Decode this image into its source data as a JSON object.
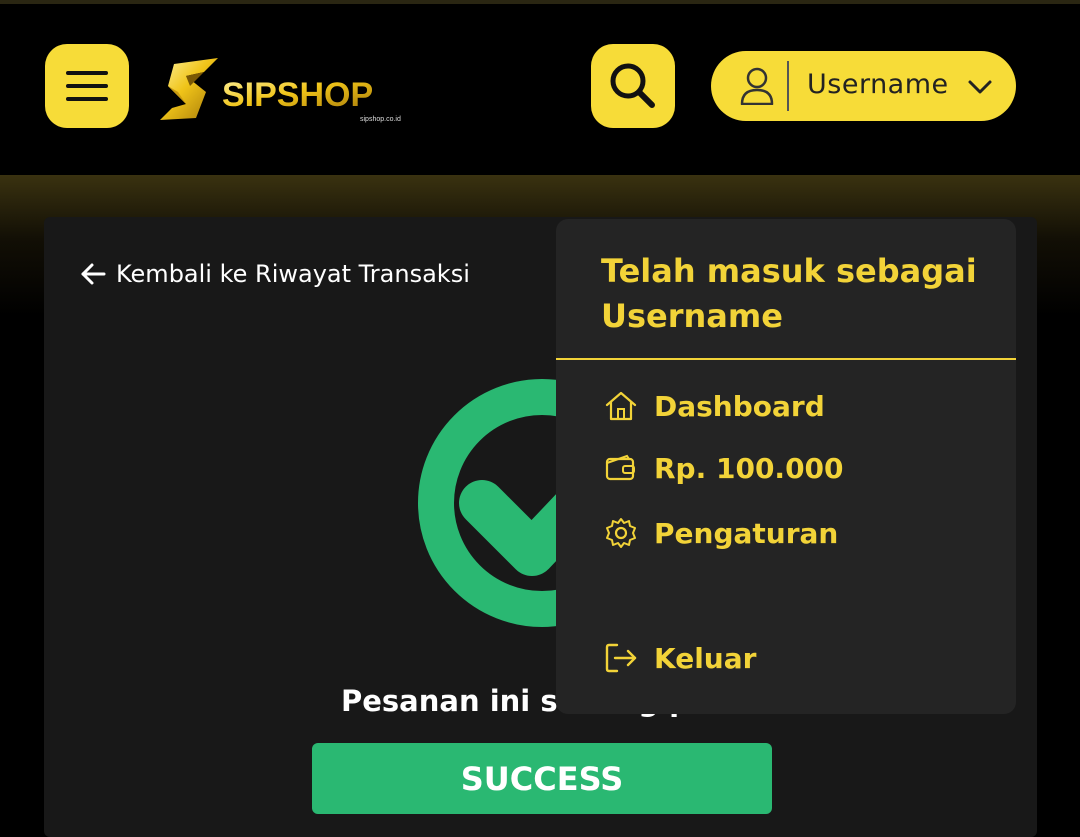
{
  "header": {
    "logo_text": "SIPSHOP",
    "logo_subtext": "sipshop.co.id",
    "username": "Username",
    "icons": {
      "menu": "hamburger-menu-icon",
      "search": "search-icon",
      "user": "user-icon",
      "chevron": "chevron-down-icon"
    }
  },
  "colors": {
    "accent": "#f7dc38",
    "success": "#2ab872",
    "background": "#000000",
    "card": "#181818",
    "dropdown": "#242424"
  },
  "page": {
    "back_link": "Kembali ke Riwayat Transaksi",
    "status_text": "Pesanan ini sedang p",
    "success_label": "SUCCESS"
  },
  "dropdown": {
    "heading_line1": "Telah masuk sebagai",
    "heading_line2": "Username",
    "items": [
      {
        "label": "Dashboard",
        "icon": "home-icon"
      },
      {
        "label": "Rp. 100.000",
        "icon": "wallet-icon"
      },
      {
        "label": "Pengaturan",
        "icon": "gear-icon"
      },
      {
        "label": "Keluar",
        "icon": "logout-icon"
      }
    ]
  }
}
